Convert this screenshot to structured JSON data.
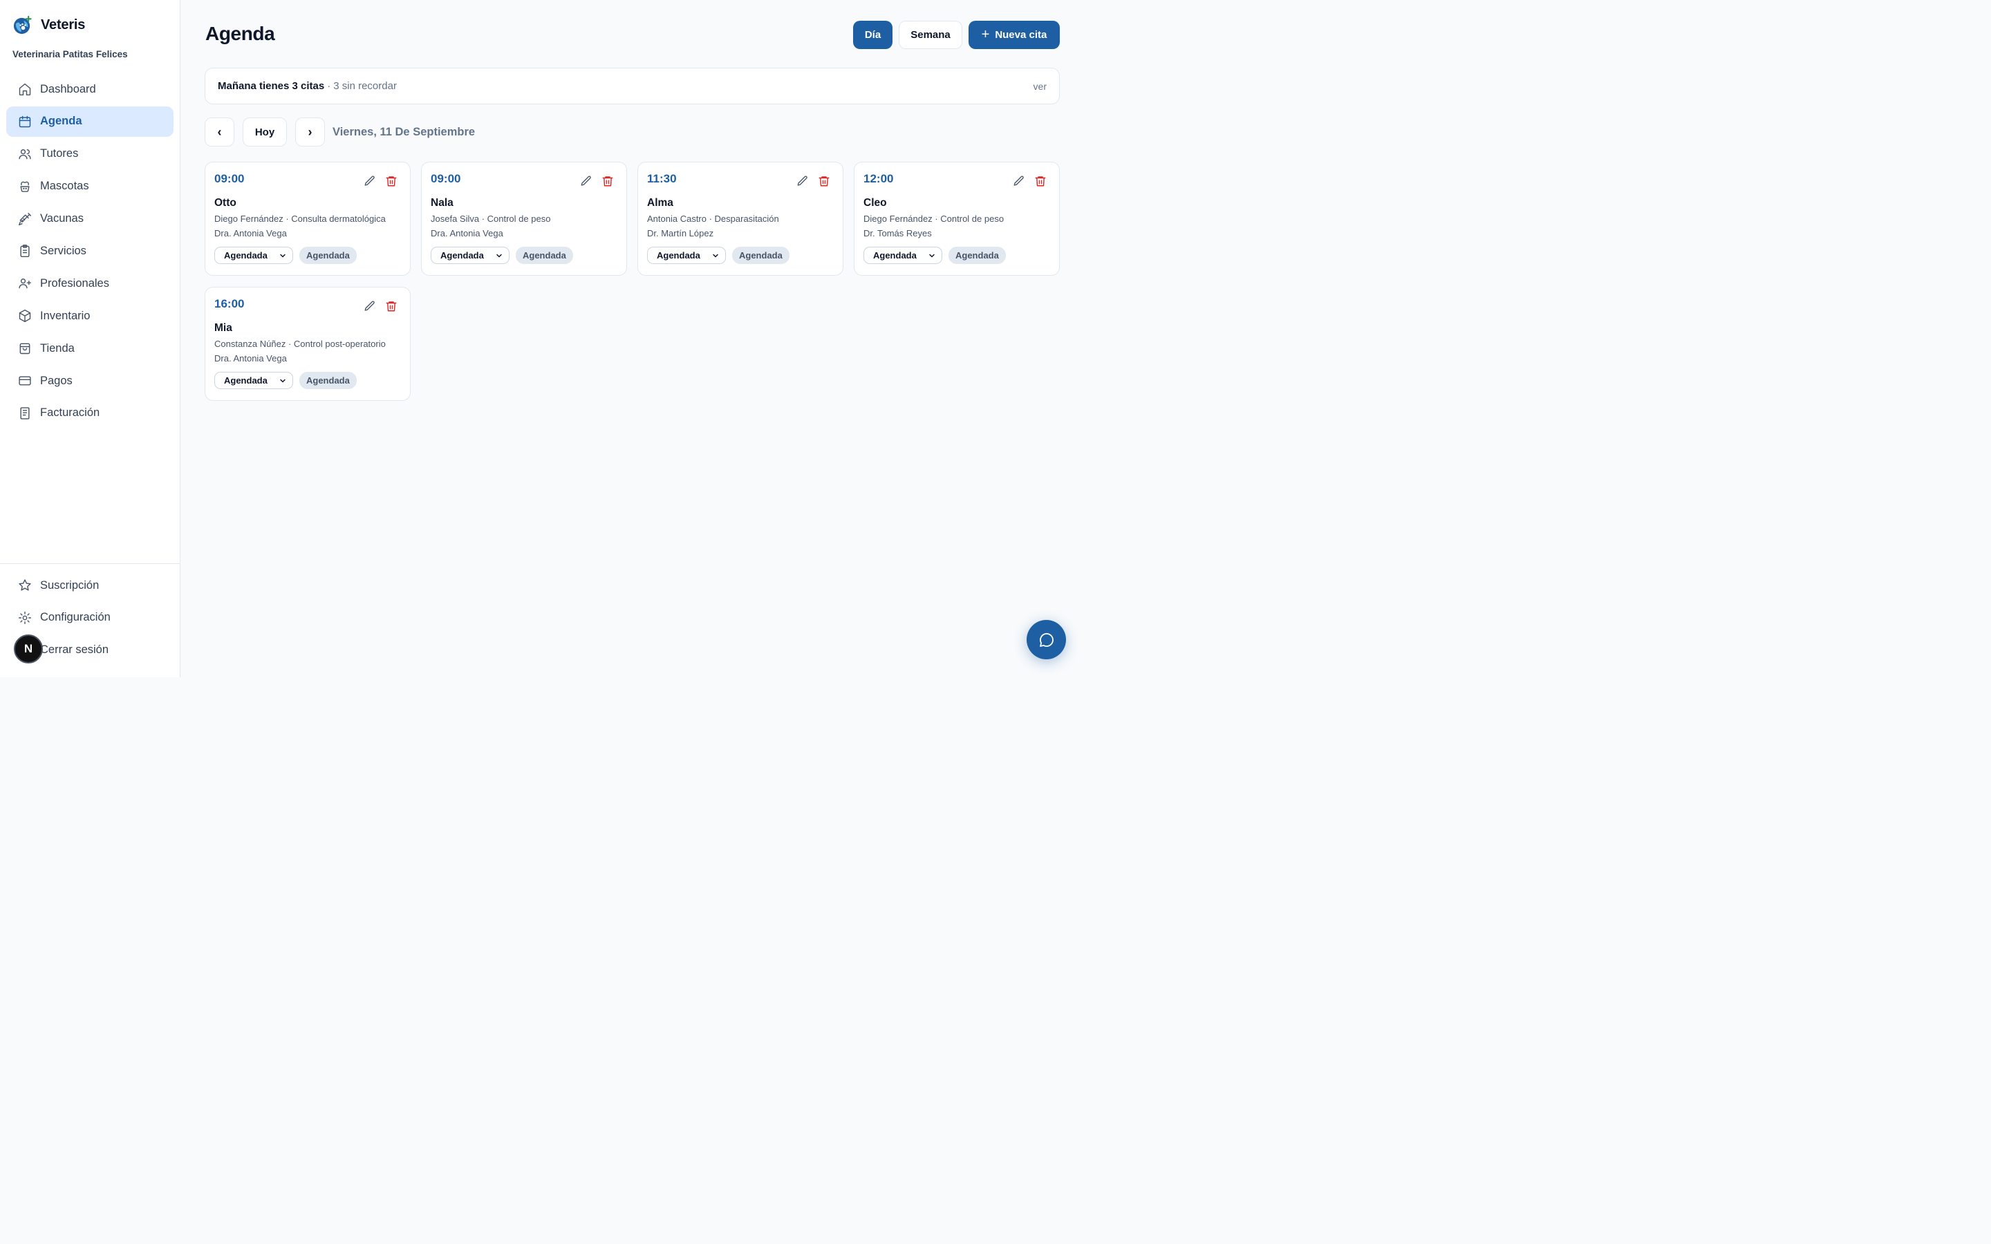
{
  "brand": {
    "name": "Veteris",
    "clinic": "Veterinaria Patitas Felices"
  },
  "sidebar": {
    "items": [
      {
        "label": "Dashboard",
        "icon": "home-icon"
      },
      {
        "label": "Agenda",
        "icon": "calendar-icon",
        "active": true
      },
      {
        "label": "Tutores",
        "icon": "users-icon"
      },
      {
        "label": "Mascotas",
        "icon": "paw-icon"
      },
      {
        "label": "Vacunas",
        "icon": "syringe-icon"
      },
      {
        "label": "Servicios",
        "icon": "clipboard-icon"
      },
      {
        "label": "Profesionales",
        "icon": "user-plus-icon"
      },
      {
        "label": "Inventario",
        "icon": "box-icon"
      },
      {
        "label": "Tienda",
        "icon": "shopping-bag-icon"
      },
      {
        "label": "Pagos",
        "icon": "credit-card-icon"
      },
      {
        "label": "Facturación",
        "icon": "receipt-icon"
      }
    ],
    "bottom": [
      {
        "label": "Suscripción",
        "icon": "star-icon"
      },
      {
        "label": "Configuración",
        "icon": "gear-icon"
      },
      {
        "label": "Cerrar sesión",
        "icon": "logout-icon"
      }
    ]
  },
  "header": {
    "title": "Agenda",
    "day_label": "Día",
    "week_label": "Semana",
    "new_label": "Nueva cita"
  },
  "notice": {
    "strong": "Mañana tienes 3 citas",
    "separator": "·",
    "muted": "3 sin recordar",
    "link": "ver"
  },
  "datebar": {
    "prev": "‹",
    "today": "Hoy",
    "next": "›",
    "date": "Viernes, 11 De Septiembre"
  },
  "appointments": [
    {
      "time": "09:00",
      "pet": "Otto",
      "detail": "Diego Fernández · Consulta dermatológica",
      "vet": "Dra. Antonia Vega",
      "status": "Agendada",
      "badge": "Agendada"
    },
    {
      "time": "09:00",
      "pet": "Nala",
      "detail": "Josefa Silva · Control de peso",
      "vet": "Dra. Antonia Vega",
      "status": "Agendada",
      "badge": "Agendada"
    },
    {
      "time": "11:30",
      "pet": "Alma",
      "detail": "Antonia Castro · Desparasitación",
      "vet": "Dr. Martín López",
      "status": "Agendada",
      "badge": "Agendada"
    },
    {
      "time": "12:00",
      "pet": "Cleo",
      "detail": "Diego Fernández · Control de peso",
      "vet": "Dr. Tomás Reyes",
      "status": "Agendada",
      "badge": "Agendada"
    },
    {
      "time": "16:00",
      "pet": "Mia",
      "detail": "Constanza Núñez · Control post-operatorio",
      "vet": "Dra. Antonia Vega",
      "status": "Agendada",
      "badge": "Agendada"
    }
  ],
  "badge_letter": "N",
  "colors": {
    "primary": "#1e5fa3",
    "active_bg": "#dbeafe",
    "danger": "#dc2626"
  }
}
